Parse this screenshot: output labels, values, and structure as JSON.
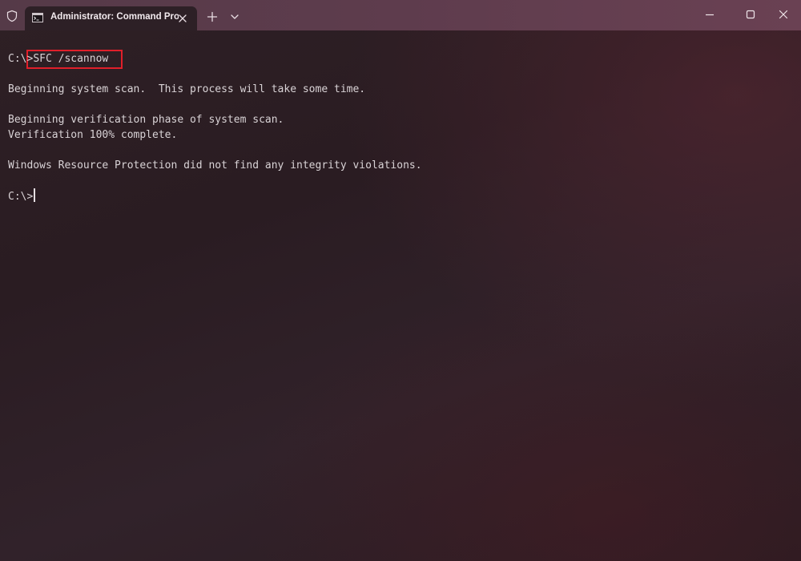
{
  "titlebar": {
    "tab_title": "Administrator: Command Pro",
    "icons": {
      "shield": "shield-icon",
      "tab": "cmd-icon",
      "close_tab": "close-icon",
      "new_tab": "plus-icon",
      "dropdown": "chevron-down-icon",
      "minimize": "minimize-icon",
      "maximize": "maximize-icon",
      "close": "close-icon"
    }
  },
  "terminal": {
    "prompt1": "C:\\>",
    "command": "SFC /scannow",
    "out1": "Beginning system scan.  This process will take some time.",
    "out2": "Beginning verification phase of system scan.",
    "out3": "Verification 100% complete.",
    "out4": "Windows Resource Protection did not find any integrity violations.",
    "prompt2": "C:\\>"
  },
  "colors": {
    "titlebar": "#5e3c4d",
    "background": "#2a1d22",
    "text": "#d9d3d6",
    "highlight_border": "#e01f2a"
  }
}
